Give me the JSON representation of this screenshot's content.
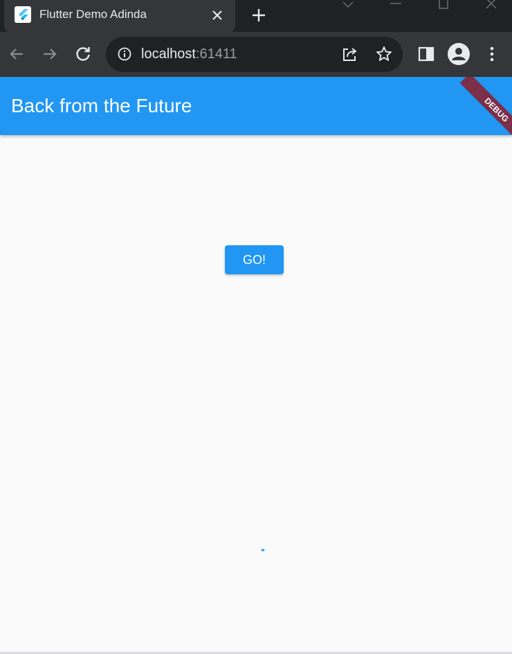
{
  "browser": {
    "tab": {
      "title": "Flutter Demo Adinda",
      "favicon_icon": "flutter-logo-icon"
    },
    "address_bar": {
      "host": "localhost",
      "port": ":61411"
    },
    "colors": {
      "frame": "#202124",
      "toolbar": "#35363a"
    }
  },
  "app": {
    "title": "Back from the Future",
    "debug_banner": "DEBUG",
    "go_button_label": "GO!",
    "colors": {
      "primary": "#2196f3",
      "background": "#fafafa",
      "banner": "#7b2f48"
    }
  }
}
